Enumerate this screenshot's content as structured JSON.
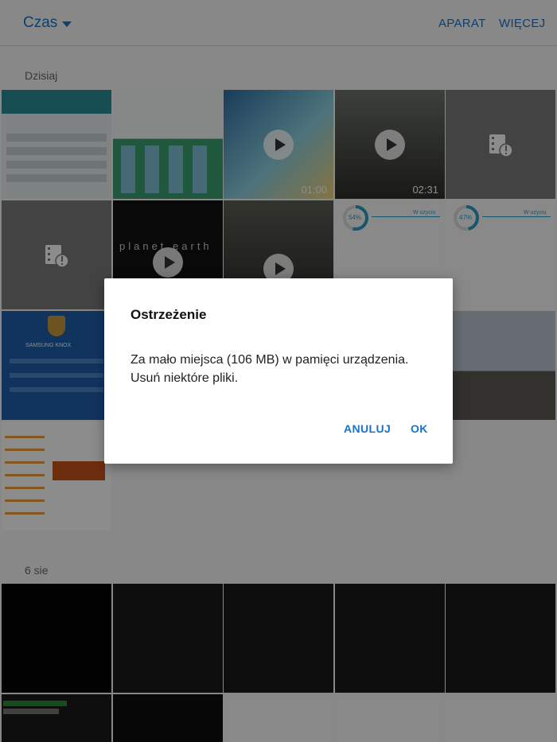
{
  "appbar": {
    "title": "Czas",
    "actions": [
      "APARAT",
      "WIĘCEJ"
    ]
  },
  "sections": [
    {
      "label": "Dzisiaj"
    },
    {
      "label": "6 sie"
    }
  ],
  "videos": [
    {
      "duration": "01:00"
    },
    {
      "duration": "02:31"
    }
  ],
  "thumbnail_texts": {
    "storage_1": "54%",
    "storage_2": "47%",
    "storage_label": "W użyciu",
    "planet": "planet earth",
    "knox": "SAMSUNG KNOX"
  },
  "dialog": {
    "title": "Ostrzeżenie",
    "message": "Za mało miejsca (106 MB) w pamięci urządzenia. Usuń niektóre pliki.",
    "cancel_label": "ANULUJ",
    "ok_label": "OK"
  },
  "colors": {
    "accent": "#1a73c7",
    "scrim": "rgba(0,0,0,0.45)"
  }
}
